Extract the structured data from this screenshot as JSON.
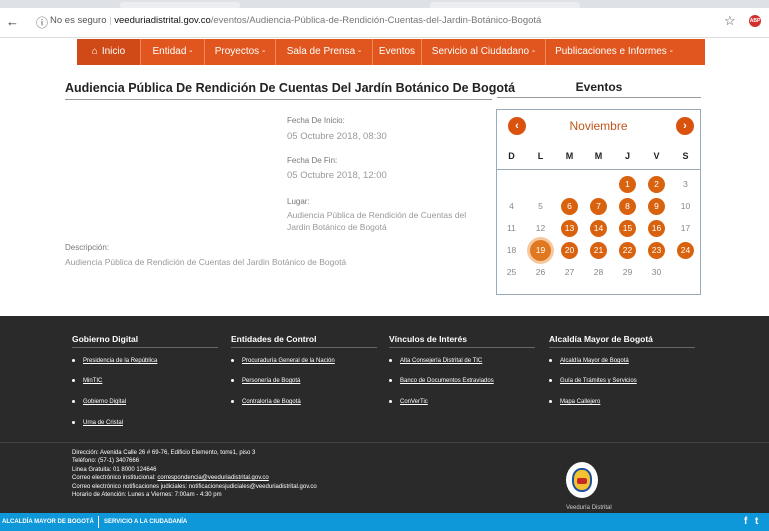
{
  "browser": {
    "back_glyph": "←",
    "info_glyph": "ⓘ",
    "security_label": "No es seguro",
    "domain": "veeduriadistrital.gov.co",
    "path": "/eventos/Audiencia-Pública-de-Rendición-Cuentas-del-Jardin-Botánico-Bogotá",
    "star_glyph": "☆",
    "extension_label": "ABP"
  },
  "nav": {
    "items": [
      {
        "label": "Inicio",
        "home_glyph": "⌂"
      },
      {
        "label": "Entidad -"
      },
      {
        "label": "Proyectos -"
      },
      {
        "label": "Sala de Prensa -"
      },
      {
        "label": "Eventos"
      },
      {
        "label": "Servicio al Ciudadano -"
      },
      {
        "label": "Publicaciones e Informes -"
      }
    ]
  },
  "event": {
    "title": "Audiencia Pública De Rendición De Cuentas Del Jardín Botánico De Bogotá",
    "start_label": "Fecha De Inicio:",
    "start_value": "05 Octubre 2018, 08:30",
    "end_label": "Fecha De Fin:",
    "end_value": "05 Octubre 2018, 12:00",
    "place_label": "Lugar:",
    "place_line1": "Audiencia Pública de Rendición de Cuentas del",
    "place_line2": "Jardin Botánico de Bogotá",
    "desc_label": "Descripción:",
    "desc_value": "Audiencia Pública de Rendición de Cuentas del Jardin Botánico de Bogotá"
  },
  "sidebar": {
    "heading": "Eventos"
  },
  "calendar": {
    "month": "Noviembre",
    "prev_glyph": "‹",
    "next_glyph": "›",
    "weekdays": [
      "D",
      "L",
      "M",
      "M",
      "J",
      "V",
      "S"
    ],
    "weeks": [
      [
        null,
        null,
        null,
        null,
        "1",
        "2",
        "3"
      ],
      [
        "4",
        "5",
        "6",
        "7",
        "8",
        "9",
        "10"
      ],
      [
        "11",
        "12",
        "13",
        "14",
        "15",
        "16",
        "17"
      ],
      [
        "18",
        "19",
        "20",
        "21",
        "22",
        "23",
        "24"
      ],
      [
        "25",
        "26",
        "27",
        "28",
        "29",
        "30",
        null
      ]
    ],
    "event_days": [
      "1",
      "2",
      "6",
      "7",
      "8",
      "9",
      "13",
      "14",
      "15",
      "16",
      "19",
      "20",
      "21",
      "22",
      "23",
      "24"
    ],
    "today": "19",
    "accent_color": "#d9620f"
  },
  "footer": {
    "columns": [
      {
        "heading": "Gobierno Digital",
        "links": [
          "Presidencia de la República",
          "MinTIC",
          "Gobierno Digital",
          "Urna de Cristal"
        ]
      },
      {
        "heading": "Entidades de Control",
        "links": [
          "Procuraduría General de la Nación",
          "Personería de Bogotá",
          "Contraloría de Bogotá"
        ]
      },
      {
        "heading": "Vínculos de Interés",
        "links": [
          "Alta Consejería Distrital de TIC",
          "Banco de Documentos Extraviados",
          "ConVerTic"
        ]
      },
      {
        "heading": "Alcaldía Mayor de Bogotá",
        "links": [
          "Alcaldía Mayor de Bogotá",
          "Guía de Trámites y Servicios",
          "Mapa Callejero"
        ]
      }
    ],
    "address": "Dirección: Avenida Calle 26 # 69-76, Edificio Elemento, torre1, piso 3",
    "phone": "Teléfono: (57-1) 3407666",
    "toll_free": "Linea Gratuita: 01 8000 124646",
    "email_label": "Correo electrónico institucional:",
    "email": "correspondencia@veeduriadistrital.gov.co",
    "judicial_email": "Correo electrónico notificaciones judiciales: notificacionesjudiciales@veeduriadistrital.gov.co",
    "hours": "Horario de Atención: Lunes a Viernes: 7:00am - 4:30 pm",
    "seal_caption": "Veeduría Distrital"
  },
  "bottom_bar": {
    "left_label": "ALCALDÍA MAYOR DE BOGOTÁ",
    "right_label": "SERVICIO A LA CIUDADANÍA",
    "facebook_glyph": "f",
    "twitter_glyph": "t",
    "color": "#0e97d9"
  }
}
